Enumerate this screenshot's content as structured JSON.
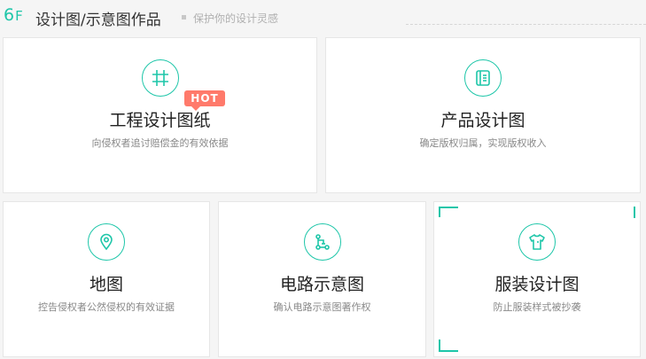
{
  "floor": {
    "number": "6",
    "suffix": "F",
    "title": "设计图/示意图作品",
    "subtitle": "保护你的设计灵感"
  },
  "cards": [
    {
      "title": "工程设计图纸",
      "desc": "向侵权者追讨赔偿金的有效依据",
      "icon": "grid-icon",
      "badge": "HOT"
    },
    {
      "title": "产品设计图",
      "desc": "确定版权归属，实现版权收入",
      "icon": "notebook-icon"
    },
    {
      "title": "地图",
      "desc": "控告侵权者公然侵权的有效证据",
      "icon": "map-pin-icon"
    },
    {
      "title": "电路示意图",
      "desc": "确认电路示意图著作权",
      "icon": "circuit-icon"
    },
    {
      "title": "服装设计图",
      "desc": "防止服装样式被抄袭",
      "icon": "shirt-icon"
    }
  ],
  "colors": {
    "accent": "#1ec6a9",
    "hot": "#ff7a6b",
    "background": "#f5f5f5",
    "card": "#ffffff"
  }
}
